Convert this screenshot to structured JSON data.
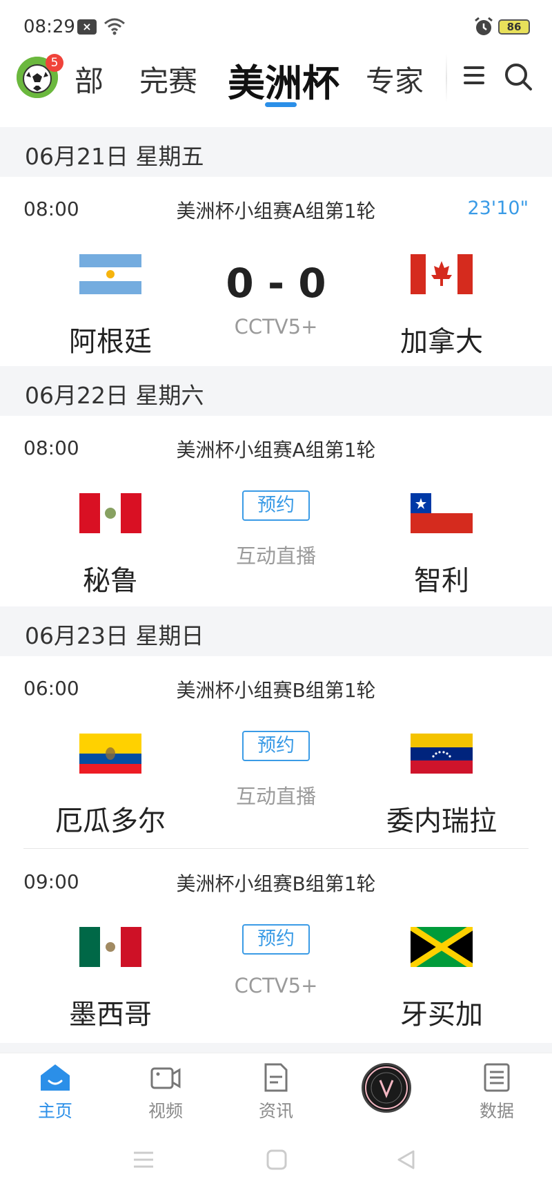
{
  "status_bar": {
    "time": "08:29",
    "battery": "86"
  },
  "top_nav": {
    "badge_count": "5",
    "tabs": [
      {
        "label": "部"
      },
      {
        "label": "完赛"
      },
      {
        "label": "美洲杯"
      },
      {
        "label": "专家"
      }
    ],
    "active_tab_color": "#2b8fe8"
  },
  "days": [
    {
      "date": "06月21日 星期五",
      "matches": [
        {
          "time": "08:00",
          "league": "美洲杯小组赛A组第1轮",
          "clock": "23'10\"",
          "home": "阿根廷",
          "away": "加拿大",
          "score": "0 - 0",
          "channel": "CCTV5+"
        }
      ]
    },
    {
      "date": "06月22日 星期六",
      "matches": [
        {
          "time": "08:00",
          "league": "美洲杯小组赛A组第1轮",
          "home": "秘鲁",
          "away": "智利",
          "button": "预约",
          "channel": "互动直播"
        }
      ]
    },
    {
      "date": "06月23日 星期日",
      "matches": [
        {
          "time": "06:00",
          "league": "美洲杯小组赛B组第1轮",
          "home": "厄瓜多尔",
          "away": "委内瑞拉",
          "button": "预约",
          "channel": "互动直播"
        },
        {
          "time": "09:00",
          "league": "美洲杯小组赛B组第1轮",
          "home": "墨西哥",
          "away": "牙买加",
          "button": "预约",
          "channel": "CCTV5+"
        }
      ]
    }
  ],
  "bottom_nav": {
    "items": [
      {
        "label": "主页",
        "icon": "home-icon"
      },
      {
        "label": "视频",
        "icon": "video-icon"
      },
      {
        "label": "资讯",
        "icon": "news-icon"
      },
      {
        "label": "",
        "icon": "club-logo"
      },
      {
        "label": "数据",
        "icon": "data-icon"
      }
    ],
    "active_color": "#2b8fe8",
    "inactive_color": "#8a8a8a"
  }
}
